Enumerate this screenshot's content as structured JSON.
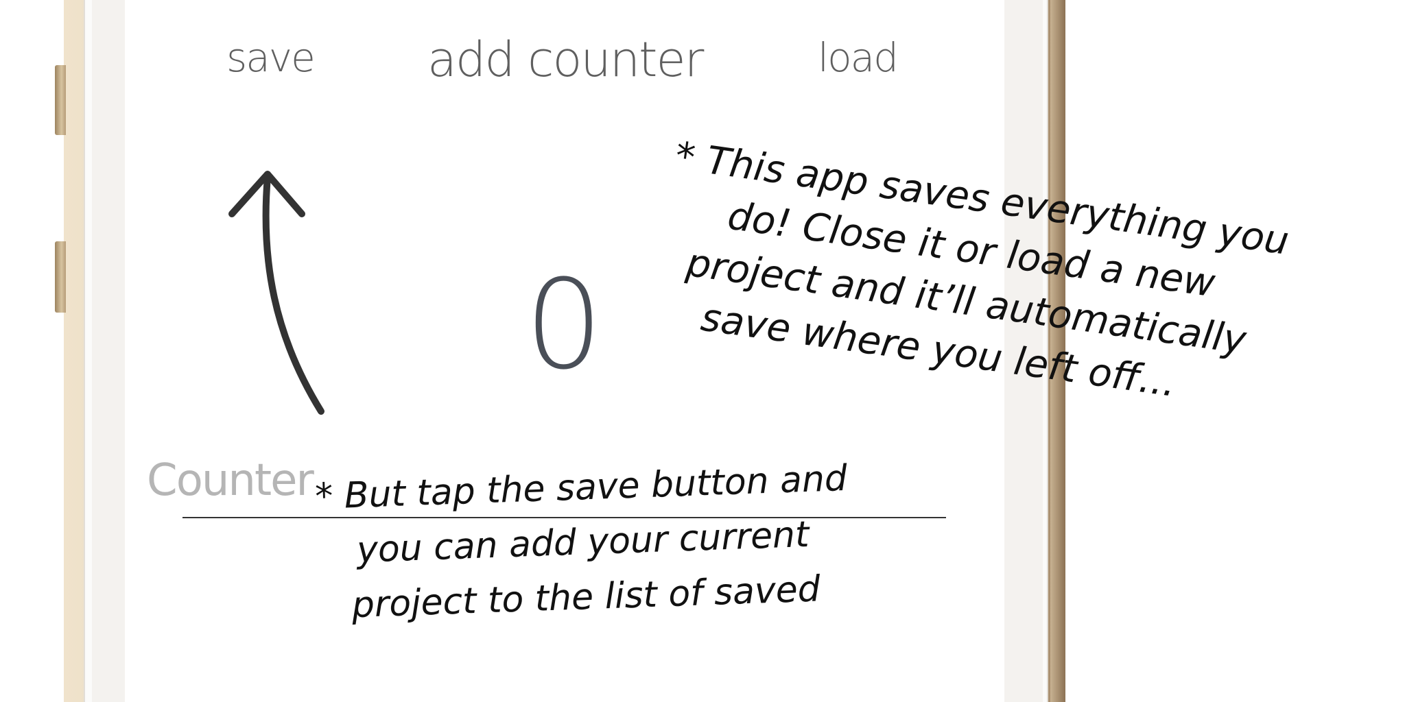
{
  "nav": {
    "save_label": "save",
    "add_counter_label": "add counter",
    "load_label": "load"
  },
  "counter": {
    "value": "0",
    "label": "Counter"
  },
  "annotations": {
    "top": [
      "* This app saves everything you",
      "do! Close it or load a new",
      "project and it’ll automatically",
      "save where you left off..."
    ],
    "bottom": [
      "* But tap the save button and",
      "you can add your current",
      "project to the list of saved"
    ]
  },
  "icons": {
    "arrow": "arrow-up-icon"
  },
  "colors": {
    "nav_text": "#5f5f5f",
    "count_text": "#4a4f58",
    "counter_label": "#b5b5b5",
    "annotation_ink": "#111111",
    "phone_gold": "#cbb597"
  }
}
